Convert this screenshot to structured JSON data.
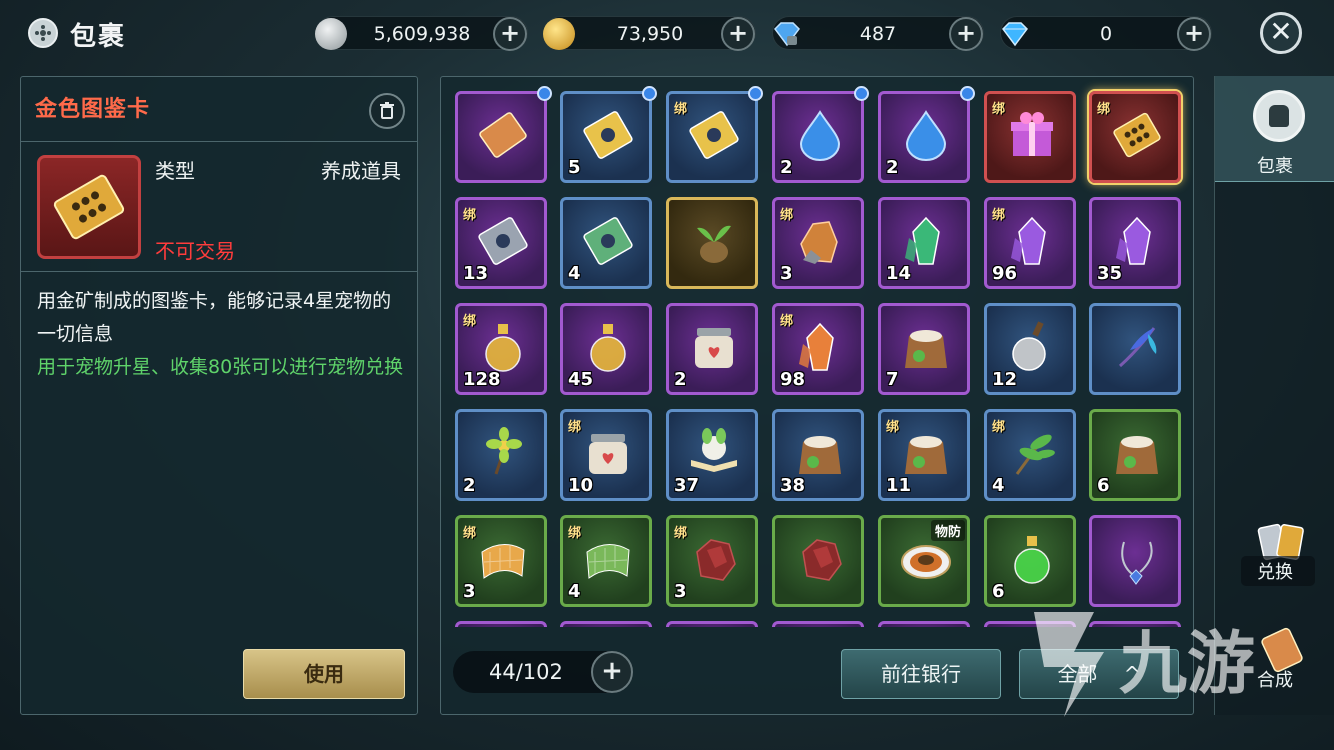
{
  "header": {
    "title": "包裹",
    "currencies": [
      {
        "name": "silver-coin",
        "value": "5,609,938",
        "color": "#b8bfc2"
      },
      {
        "name": "gold-coin",
        "value": "73,950",
        "color": "#e4b53a"
      },
      {
        "name": "locked-diamond",
        "value": "487",
        "color": "#4ea6f0"
      },
      {
        "name": "diamond",
        "value": "0",
        "color": "#3fb6ff"
      }
    ],
    "plus": "+",
    "close": "✕"
  },
  "detail": {
    "name": "金色图鉴卡",
    "type_label": "类型",
    "type_value": "养成道具",
    "trade_status": "不可交易",
    "description": "用金矿制成的图鉴卡，能够记录4星宠物的一切信息",
    "usage": "用于宠物升星、收集80张可以进行宠物兑换",
    "use_button": "使用"
  },
  "inventory": {
    "bind_label": "绑",
    "items": [
      {
        "quality": "purple",
        "count": "",
        "bind": false,
        "dot": true,
        "tag": "",
        "art": "ticket",
        "color": "#d98a4a"
      },
      {
        "quality": "blue",
        "count": "5",
        "bind": false,
        "dot": true,
        "tag": "",
        "art": "card",
        "color": "#e8c24a"
      },
      {
        "quality": "blue",
        "count": "",
        "bind": true,
        "dot": true,
        "tag": "",
        "art": "card",
        "color": "#e8c24a"
      },
      {
        "quality": "purple",
        "count": "2",
        "bind": false,
        "dot": true,
        "tag": "",
        "art": "water-drop",
        "color": "#3a8fe8"
      },
      {
        "quality": "purple",
        "count": "2",
        "bind": false,
        "dot": true,
        "tag": "",
        "art": "water-drop",
        "color": "#3a8fe8"
      },
      {
        "quality": "red",
        "count": "",
        "bind": true,
        "dot": false,
        "tag": "",
        "art": "gift-box",
        "color": "#c45ad8"
      },
      {
        "quality": "red",
        "count": "",
        "bind": true,
        "dot": false,
        "tag": "",
        "art": "gold-card",
        "color": "#e0a93a"
      },
      {
        "quality": "purple",
        "count": "13",
        "bind": true,
        "dot": false,
        "tag": "",
        "art": "card",
        "color": "#9aa3b0"
      },
      {
        "quality": "blue",
        "count": "4",
        "bind": false,
        "dot": false,
        "tag": "",
        "art": "card",
        "color": "#5fb07a"
      },
      {
        "quality": "gold",
        "count": "",
        "bind": false,
        "dot": false,
        "tag": "",
        "art": "seed",
        "color": "#8a6a3a"
      },
      {
        "quality": "purple",
        "count": "3",
        "bind": true,
        "dot": false,
        "tag": "",
        "art": "ore",
        "color": "#d0823a"
      },
      {
        "quality": "purple",
        "count": "14",
        "bind": false,
        "dot": false,
        "tag": "",
        "art": "crystal",
        "color": "#3ab878"
      },
      {
        "quality": "purple",
        "count": "96",
        "bind": true,
        "dot": false,
        "tag": "",
        "art": "crystal",
        "color": "#9a5ae0"
      },
      {
        "quality": "purple",
        "count": "35",
        "bind": false,
        "dot": false,
        "tag": "",
        "art": "crystal",
        "color": "#9a5ae0"
      },
      {
        "quality": "purple",
        "count": "128",
        "bind": true,
        "dot": false,
        "tag": "",
        "art": "potion",
        "color": "#e8b83a"
      },
      {
        "quality": "purple",
        "count": "45",
        "bind": false,
        "dot": false,
        "tag": "",
        "art": "potion",
        "color": "#e8b83a"
      },
      {
        "quality": "purple",
        "count": "2",
        "bind": false,
        "dot": false,
        "tag": "",
        "art": "jar",
        "color": "#d84a4a"
      },
      {
        "quality": "purple",
        "count": "98",
        "bind": true,
        "dot": false,
        "tag": "",
        "art": "crystal",
        "color": "#e8803a"
      },
      {
        "quality": "purple",
        "count": "7",
        "bind": false,
        "dot": false,
        "tag": "",
        "art": "food-sack",
        "color": "#c4884a"
      },
      {
        "quality": "blue",
        "count": "12",
        "bind": false,
        "dot": false,
        "tag": "",
        "art": "flask",
        "color": "#c0c4c8"
      },
      {
        "quality": "blue",
        "count": "",
        "bind": false,
        "dot": false,
        "tag": "",
        "art": "feather",
        "color": "#4a6ae0"
      },
      {
        "quality": "blue",
        "count": "2",
        "bind": false,
        "dot": false,
        "tag": "",
        "art": "flower",
        "color": "#a8d84a"
      },
      {
        "quality": "blue",
        "count": "10",
        "bind": true,
        "dot": false,
        "tag": "",
        "art": "jar",
        "color": "#d84a4a"
      },
      {
        "quality": "blue",
        "count": "37",
        "bind": false,
        "dot": false,
        "tag": "",
        "art": "book",
        "color": "#7ac85a"
      },
      {
        "quality": "blue",
        "count": "38",
        "bind": false,
        "dot": false,
        "tag": "",
        "art": "food-sack",
        "color": "#c4884a"
      },
      {
        "quality": "blue",
        "count": "11",
        "bind": true,
        "dot": false,
        "tag": "",
        "art": "food-sack",
        "color": "#c4884a"
      },
      {
        "quality": "blue",
        "count": "4",
        "bind": true,
        "dot": false,
        "tag": "",
        "art": "herb",
        "color": "#5ab84a"
      },
      {
        "quality": "green",
        "count": "6",
        "bind": false,
        "dot": false,
        "tag": "",
        "art": "food-sack",
        "color": "#c4884a"
      },
      {
        "quality": "green",
        "count": "3",
        "bind": true,
        "dot": false,
        "tag": "",
        "art": "cloth",
        "color": "#e8a84a"
      },
      {
        "quality": "green",
        "count": "4",
        "bind": true,
        "dot": false,
        "tag": "",
        "art": "cloth",
        "color": "#7ab85a"
      },
      {
        "quality": "green",
        "count": "3",
        "bind": true,
        "dot": false,
        "tag": "",
        "art": "meat",
        "color": "#8a2a2a"
      },
      {
        "quality": "green",
        "count": "",
        "bind": false,
        "dot": false,
        "tag": "",
        "art": "meat",
        "color": "#8a2a2a"
      },
      {
        "quality": "green",
        "count": "",
        "bind": false,
        "dot": false,
        "tag": "物防",
        "art": "dish",
        "color": "#e8d0a0"
      },
      {
        "quality": "green",
        "count": "6",
        "bind": false,
        "dot": false,
        "tag": "",
        "art": "potion",
        "color": "#4ad84a"
      },
      {
        "quality": "purple",
        "count": "",
        "bind": false,
        "dot": false,
        "tag": "",
        "art": "necklace",
        "color": "#4a7ae0"
      }
    ],
    "partial_row_qualities": [
      "purple",
      "purple",
      "purple",
      "purple",
      "purple",
      "purple",
      "purple"
    ],
    "capacity": "44/102",
    "bank_button": "前往银行",
    "filter_button": "全部",
    "filter_arrow": "^"
  },
  "side": {
    "bag_label": "包裹",
    "exchange_label": "兑换",
    "synth_label": "合成"
  },
  "watermark": "九游"
}
